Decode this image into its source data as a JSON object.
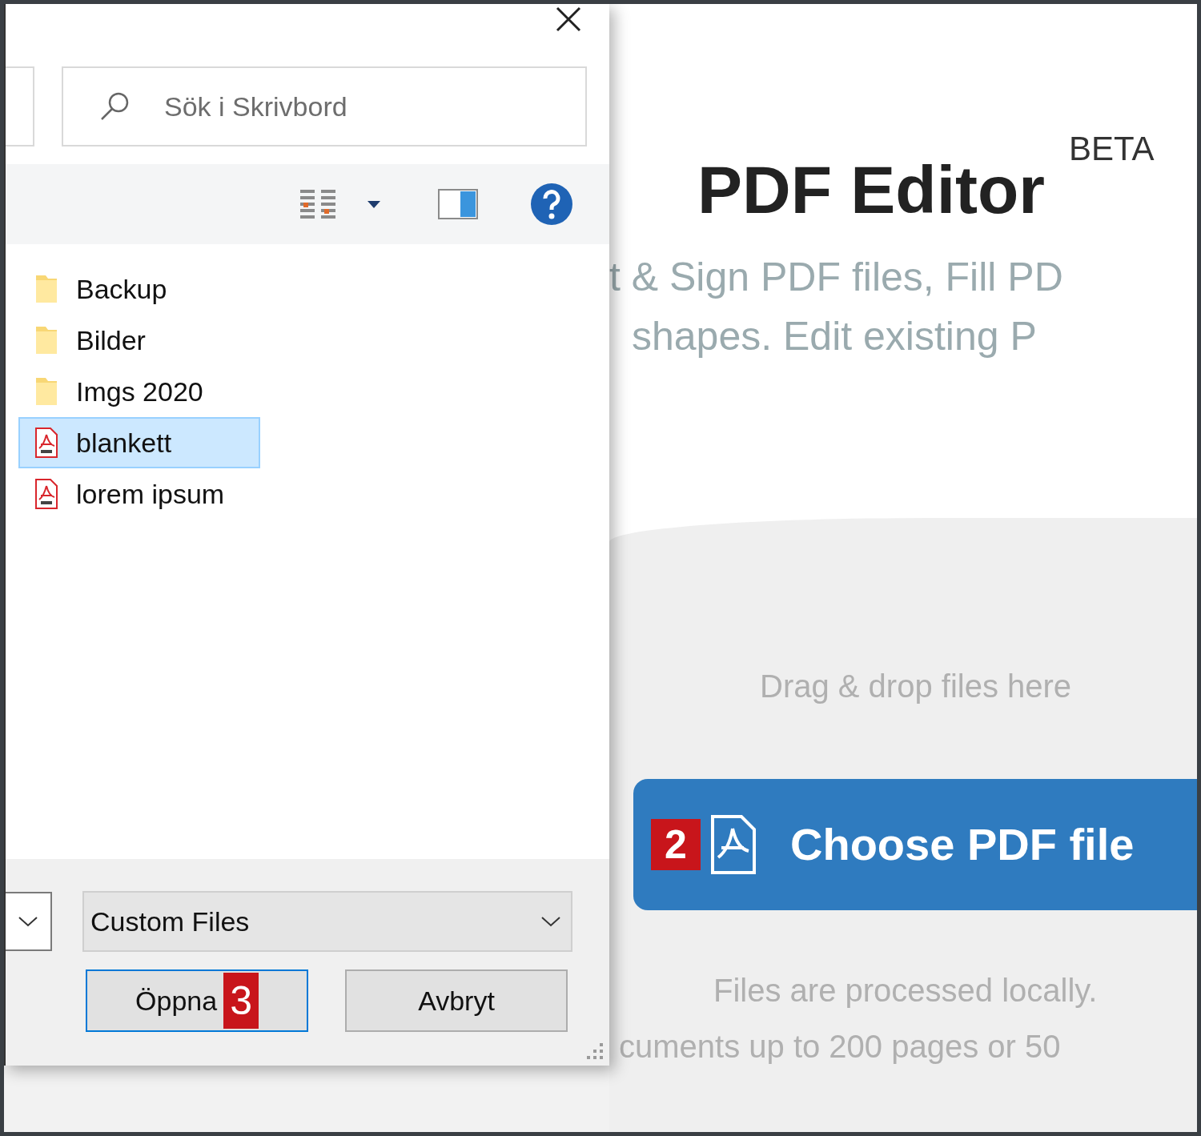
{
  "dialog": {
    "search": {
      "placeholder": "Sök i Skrivbord"
    },
    "files": [
      {
        "name": "Backup",
        "kind": "folder",
        "selected": false
      },
      {
        "name": "Bilder",
        "kind": "folder",
        "selected": false
      },
      {
        "name": "Imgs 2020",
        "kind": "folder",
        "selected": false
      },
      {
        "name": "blankett",
        "kind": "pdf",
        "selected": true
      },
      {
        "name": "lorem ipsum",
        "kind": "pdf",
        "selected": false
      }
    ],
    "file_type": {
      "value": "Custom Files"
    },
    "buttons": [
      {
        "label": "Öppna",
        "badge": "3",
        "focused": true
      },
      {
        "label": "Avbryt",
        "focused": false
      }
    ]
  },
  "page": {
    "title": "PDF Editor",
    "tag": "BETA",
    "subtitle_lines": [
      "t & Sign PDF files, Fill PD",
      "shapes. Edit existing P"
    ],
    "drop_hint": "Drag & drop files here",
    "choose_button": {
      "badge": "2",
      "label": "Choose PDF file"
    },
    "notes": [
      "Files are processed locally.",
      "cuments up to 200 pages or 50"
    ]
  }
}
